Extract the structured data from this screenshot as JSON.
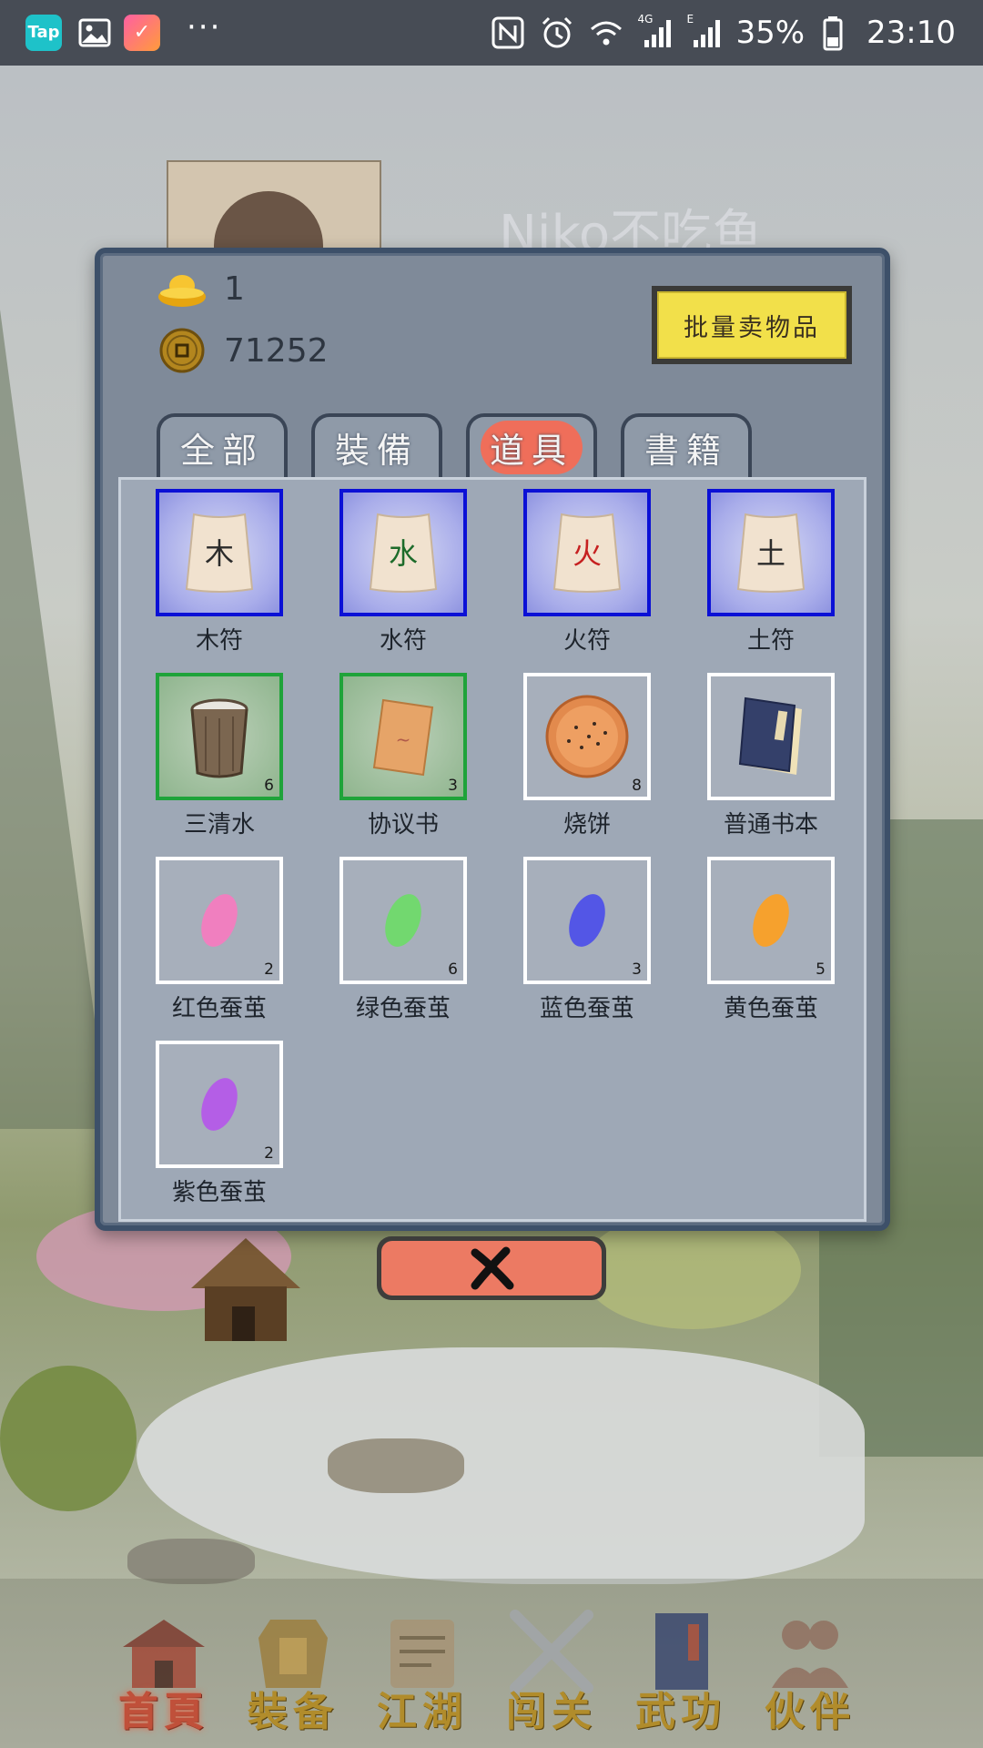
{
  "status_bar": {
    "app_tap": "Tap",
    "more": "···",
    "network_4g": "4G",
    "network_e": "E",
    "battery": "35%",
    "time": "23:10"
  },
  "profile": {
    "name": "Niko不吃鱼"
  },
  "resources": {
    "gold_ingot": "1",
    "copper_coins": "71252"
  },
  "bulk_sell_label": "批量卖物品",
  "tabs": [
    {
      "label": "全部",
      "active": false
    },
    {
      "label": "裝備",
      "active": false
    },
    {
      "label": "道具",
      "active": true
    },
    {
      "label": "書籍",
      "active": false
    }
  ],
  "items": [
    {
      "name": "木符",
      "glyph": "木",
      "count": "",
      "rarity": "blue",
      "icon": "talisman-icon",
      "glyph_color": "#2b2b2b"
    },
    {
      "name": "水符",
      "glyph": "水",
      "count": "",
      "rarity": "blue",
      "icon": "talisman-icon",
      "glyph_color": "#1d6b2a"
    },
    {
      "name": "火符",
      "glyph": "火",
      "count": "",
      "rarity": "blue",
      "icon": "talisman-icon",
      "glyph_color": "#c62020"
    },
    {
      "name": "土符",
      "glyph": "土",
      "count": "",
      "rarity": "blue",
      "icon": "talisman-icon",
      "glyph_color": "#2b2b2b"
    },
    {
      "name": "三清水",
      "glyph": "",
      "count": "6",
      "rarity": "green",
      "icon": "bucket-icon"
    },
    {
      "name": "协议书",
      "glyph": "",
      "count": "3",
      "rarity": "green",
      "icon": "scroll-icon"
    },
    {
      "name": "烧饼",
      "glyph": "",
      "count": "8",
      "rarity": "white",
      "icon": "flatbread-icon"
    },
    {
      "name": "普通书本",
      "glyph": "",
      "count": "",
      "rarity": "white",
      "icon": "book-icon"
    },
    {
      "name": "红色蚕茧",
      "glyph": "",
      "count": "2",
      "rarity": "white",
      "icon": "cocoon-icon",
      "color": "#f07fbf"
    },
    {
      "name": "绿色蚕茧",
      "glyph": "",
      "count": "6",
      "rarity": "white",
      "icon": "cocoon-icon",
      "color": "#72d86f"
    },
    {
      "name": "蓝色蚕茧",
      "glyph": "",
      "count": "3",
      "rarity": "white",
      "icon": "cocoon-icon",
      "color": "#5356e6"
    },
    {
      "name": "黄色蚕茧",
      "glyph": "",
      "count": "5",
      "rarity": "white",
      "icon": "cocoon-icon",
      "color": "#f6a12d"
    },
    {
      "name": "紫色蚕茧",
      "glyph": "",
      "count": "2",
      "rarity": "white",
      "icon": "cocoon-icon",
      "color": "#b45ee6"
    }
  ],
  "bottom_nav": [
    {
      "label": "首頁",
      "icon": "house-icon",
      "active": true
    },
    {
      "label": "裝备",
      "icon": "armor-icon",
      "active": false
    },
    {
      "label": "江湖",
      "icon": "map-scroll-icon",
      "active": false
    },
    {
      "label": "闯关",
      "icon": "crossed-swords-icon",
      "active": false
    },
    {
      "label": "武功",
      "icon": "manual-icon",
      "active": false
    },
    {
      "label": "伙伴",
      "icon": "partners-icon",
      "active": false
    }
  ],
  "colors": {
    "panel_bg": "#7f8a99",
    "panel_border": "#3d5069",
    "bulk_sell_bg": "#f2e04a",
    "active_tab_highlight": "#ef6e5a",
    "close_button_bg": "#ec7a63",
    "rarity_blue": "#0b10d6",
    "rarity_green": "#1fa33a",
    "nav_label": "#b18c2b",
    "nav_active": "#c0503a"
  }
}
